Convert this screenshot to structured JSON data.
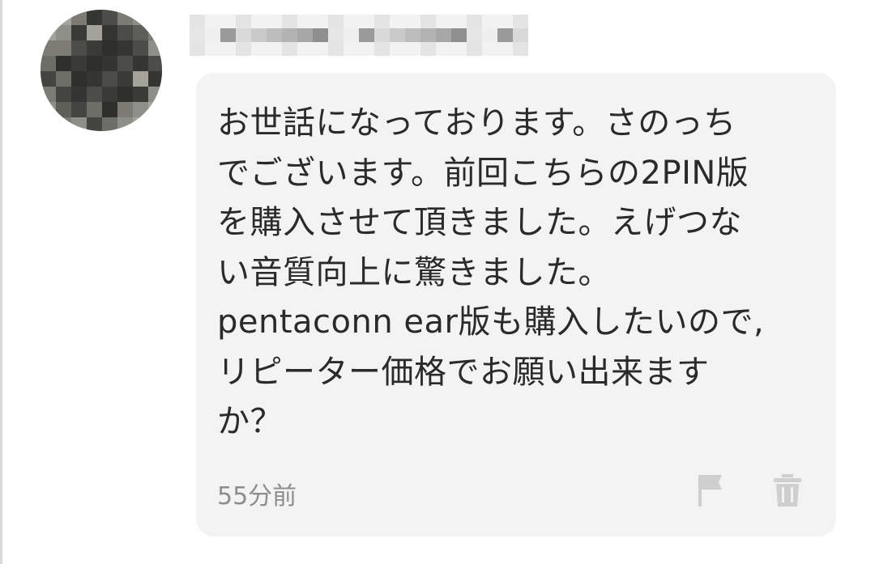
{
  "comment": {
    "message_lines": [
      "お世話になっております。さのっち",
      "でございます。前回こちらの2PIN版",
      "を購入させて頂きました。えげつな",
      "い音質向上に驚きました。",
      "pentaconn ear版も購入したいので,",
      "リピーター価格でお願い出来ます",
      "か？"
    ],
    "timestamp": "55分前",
    "actions": {
      "flag_icon": "flag-icon",
      "trash_icon": "trash-icon"
    }
  },
  "colors": {
    "bubble_bg": "#f3f3f3",
    "text": "#2a2a2a",
    "muted": "#8d8d8d",
    "icon": "#cfcfcf"
  }
}
